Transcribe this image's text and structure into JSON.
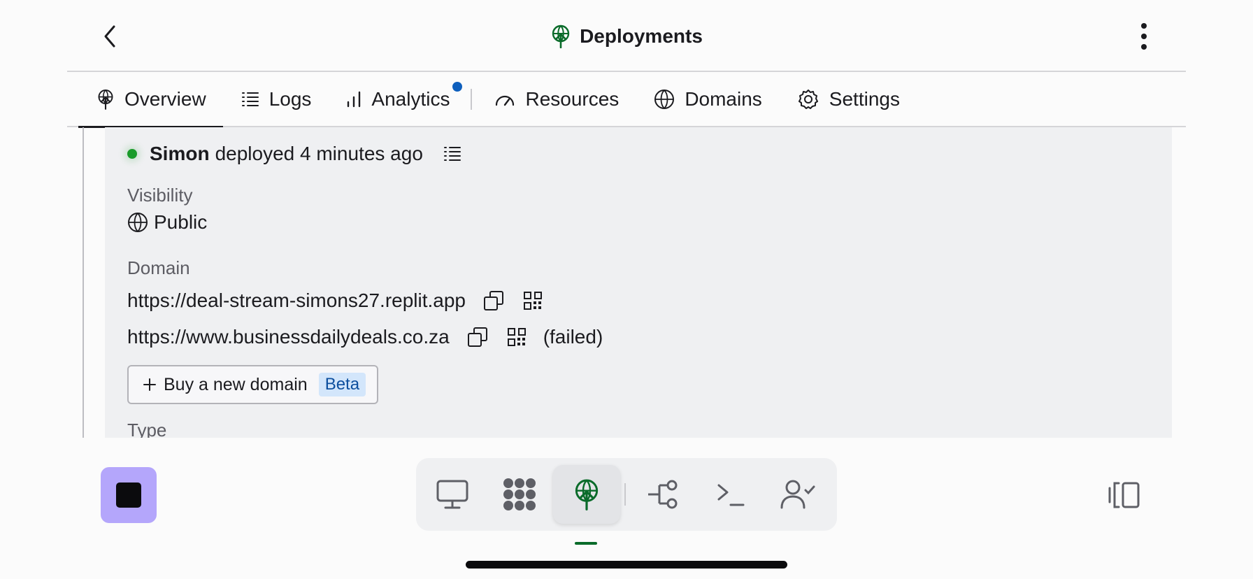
{
  "header": {
    "title": "Deployments",
    "back_icon": "chevron-left-icon",
    "title_icon": "deployments-icon",
    "more_icon": "more-vertical-icon"
  },
  "tabs": [
    {
      "label": "Overview",
      "icon": "deployments-icon",
      "active": true
    },
    {
      "label": "Logs",
      "icon": "list-icon",
      "active": false
    },
    {
      "label": "Analytics",
      "icon": "bar-chart-icon",
      "active": false,
      "badge": true
    },
    {
      "label": "Resources",
      "icon": "gauge-icon",
      "active": false
    },
    {
      "label": "Domains",
      "icon": "globe-icon",
      "active": false
    },
    {
      "label": "Settings",
      "icon": "gear-icon",
      "active": false
    }
  ],
  "deployment": {
    "user": "Simon",
    "action_text": "deployed 4 minutes ago",
    "status_color": "#1a9b2a",
    "visibility_label": "Visibility",
    "visibility_value": "Public",
    "domain_label": "Domain",
    "domains": [
      {
        "url": "https://deal-stream-simons27.replit.app",
        "status": ""
      },
      {
        "url": "https://www.businessdailydeals.co.za",
        "status": "(failed)"
      }
    ],
    "buy_domain_label": "Buy a new domain",
    "beta_label": "Beta",
    "type_label": "Type"
  },
  "bottom_bar": {
    "stop_color": "#b4a6fb",
    "tools": [
      {
        "name": "webview-icon",
        "active": false
      },
      {
        "name": "apps-icon",
        "active": false
      },
      {
        "name": "deployments-icon",
        "active": true
      },
      {
        "name": "git-icon",
        "active": false
      },
      {
        "name": "shell-icon",
        "active": false
      },
      {
        "name": "user-check-icon",
        "active": false
      }
    ]
  },
  "colors": {
    "accent_green": "#0a6b2a",
    "badge_blue": "#0e5fbd",
    "beta_bg": "#d3e6fb"
  }
}
